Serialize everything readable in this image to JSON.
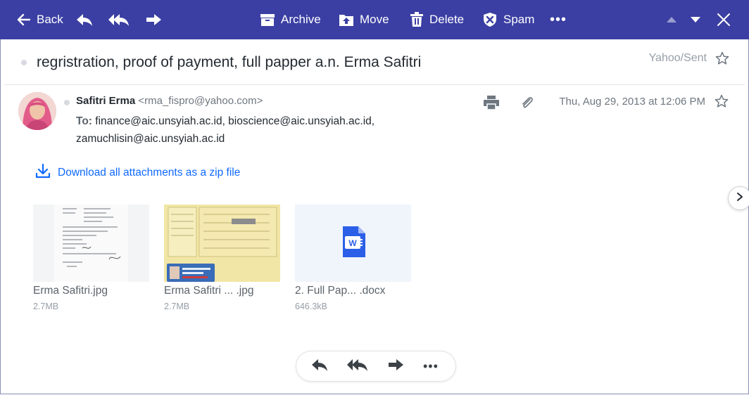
{
  "toolbar": {
    "back_label": "Back",
    "archive_label": "Archive",
    "move_label": "Move",
    "delete_label": "Delete",
    "spam_label": "Spam",
    "more_label": "•••"
  },
  "message": {
    "subject": "regristration, proof of payment, full papper a.n. Erma Safitri",
    "folder": "Yahoo/Sent",
    "sender_name": "Safitri Erma",
    "sender_email": "<rma_fispro@yahoo.com>",
    "to_label": "To:",
    "recipients_line1": "finance@aic.unsyiah.ac.id,  bioscience@aic.unsyiah.ac.id,",
    "recipients_line2": "zamuchlisin@aic.unsyiah.ac.id",
    "date": "Thu, Aug 29, 2013 at 12:06 PM"
  },
  "download_all_label": "Download all attachments as a zip file",
  "attachments": [
    {
      "name": "Erma Safitri.jpg",
      "size": "2.7MB"
    },
    {
      "name": "Erma Safitri ... .jpg",
      "size": "2.7MB"
    },
    {
      "name": "2. Full Pap...  .docx",
      "size": "646.3kB"
    }
  ],
  "footer_actions": {
    "more_label": "•••"
  },
  "colors": {
    "toolbar_bg": "#3b3fa3",
    "link_blue": "#0f69ff",
    "word_blue": "#2b5fe8"
  },
  "icons": [
    "back-arrow-icon",
    "reply-icon",
    "reply-all-icon",
    "forward-icon",
    "archive-icon",
    "move-icon",
    "trash-icon",
    "spam-shield-icon",
    "more-icon",
    "chevron-up-icon",
    "chevron-down-icon",
    "close-icon",
    "star-icon",
    "print-icon",
    "paperclip-icon",
    "download-icon",
    "word-doc-icon",
    "chevron-right-icon"
  ]
}
